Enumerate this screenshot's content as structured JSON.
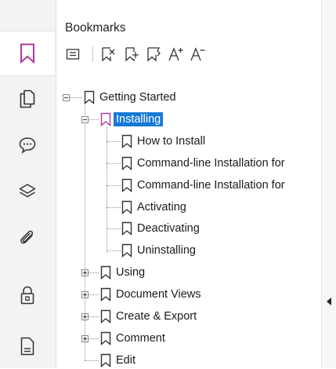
{
  "panel": {
    "title": "Bookmarks"
  },
  "colors": {
    "accent": "#b3389f",
    "selection": "#1479d8"
  },
  "left_rail": [
    {
      "icon": "bookmark-icon",
      "active": true
    },
    {
      "icon": "pages-icon"
    },
    {
      "icon": "comments-icon"
    },
    {
      "icon": "layers-icon"
    },
    {
      "icon": "attachment-icon"
    },
    {
      "icon": "security-lock-icon"
    },
    {
      "icon": "document-icon"
    }
  ],
  "toolbar": [
    "bookmark-options-icon",
    "delete-bookmark-icon",
    "add-bookmark-icon",
    "add-child-bookmark-icon",
    "increase-font-icon",
    "decrease-font-icon"
  ],
  "tree": [
    {
      "label": "Getting Started",
      "level": 0,
      "expanded": true
    },
    {
      "label": "Installing",
      "level": 1,
      "expanded": true,
      "selected": true
    },
    {
      "label": "How to Install",
      "level": 2
    },
    {
      "label": "Command-line Installation for",
      "level": 2
    },
    {
      "label": "Command-line Installation for",
      "level": 2
    },
    {
      "label": "Activating",
      "level": 2
    },
    {
      "label": "Deactivating",
      "level": 2
    },
    {
      "label": "Uninstalling",
      "level": 2
    },
    {
      "label": "Using",
      "level": 1,
      "expanded": false
    },
    {
      "label": "Document Views",
      "level": 1,
      "expanded": false
    },
    {
      "label": "Create & Export",
      "level": 1,
      "expanded": false
    },
    {
      "label": "Comment",
      "level": 1,
      "expanded": false
    },
    {
      "label": "Edit",
      "level": 1
    }
  ]
}
